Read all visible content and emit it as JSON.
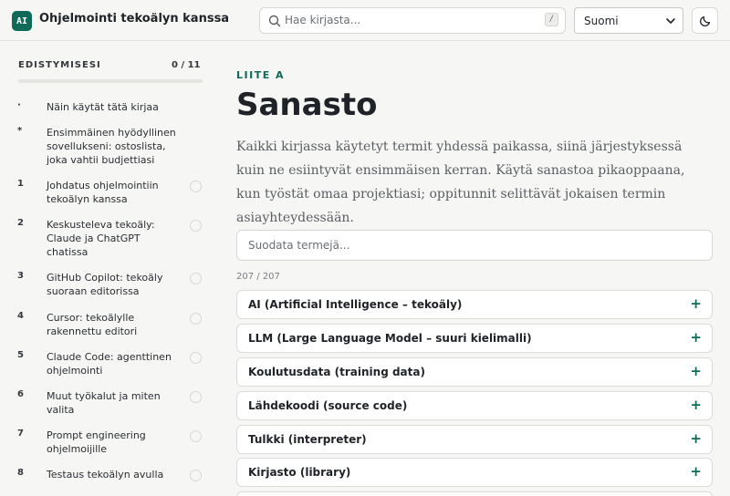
{
  "header": {
    "logo_text": "AI",
    "brand": "Ohjelmointi tekoälyn kanssa",
    "search_placeholder": "Hae kirjasta...",
    "search_shortcut": "/",
    "language": "Suomi",
    "theme_icon": "moon-icon"
  },
  "sidebar": {
    "progress_label": "EDISTYMISESI",
    "progress_count": "0 / 11",
    "progress_fraction": 0,
    "chapters": [
      {
        "num": "·",
        "title": "Näin käytät tätä kirjaa"
      },
      {
        "num": "*",
        "title": "Ensimmäinen hyödyllinen sovellukseni: ostoslista, joka vahtii budjettiasi"
      },
      {
        "num": "1",
        "title": "Johdatus ohjelmointiin tekoälyn kanssa"
      },
      {
        "num": "2",
        "title": "Keskusteleva tekoäly: Claude ja ChatGPT chatissa"
      },
      {
        "num": "3",
        "title": "GitHub Copilot: tekoäly suoraan editorissa"
      },
      {
        "num": "4",
        "title": "Cursor: tekoälylle rakennettu editori"
      },
      {
        "num": "5",
        "title": "Claude Code: agenttinen ohjelmointi"
      },
      {
        "num": "6",
        "title": "Muut työkalut ja miten valita"
      },
      {
        "num": "7",
        "title": "Prompt engineering ohjelmoijille"
      },
      {
        "num": "8",
        "title": "Testaus tekoälyn avulla"
      }
    ]
  },
  "main": {
    "eyebrow": "LIITE A",
    "title": "Sanasto",
    "lead": "Kaikki kirjassa käytetyt termit yhdessä paikassa, siinä järjestyksessä kuin ne esiintyvät ensimmäisen kerran. Käytä sanastoa pikaoppaana, kun työstät omaa projektiasi; oppitunnit selittävät jokaisen termin asiayhteydessään.",
    "filter_placeholder": "Suodata termejä...",
    "count": "207 / 207",
    "terms": [
      "AI (Artificial Intelligence – tekoäly)",
      "LLM (Large Language Model – suuri kielimalli)",
      "Koulutusdata (training data)",
      "Lähdekoodi (source code)",
      "Tulkki (interpreter)",
      "Kirjasto (library)"
    ],
    "expand_symbol": "+"
  },
  "colors": {
    "accent": "#0f6a5a",
    "background": "#f6f6f4",
    "card": "#ffffff"
  }
}
